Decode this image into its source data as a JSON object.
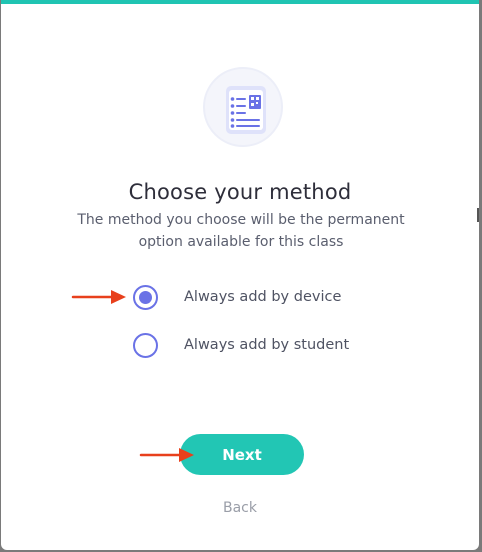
{
  "dialog": {
    "title": "Choose your method",
    "subtitle": "The method you choose will be the permanent option available for this class",
    "illustration_icon": "device-qr-list-icon"
  },
  "options": [
    {
      "label": "Always add by device",
      "selected": true
    },
    {
      "label": "Always add by student",
      "selected": false
    }
  ],
  "actions": {
    "next_label": "Next",
    "back_label": "Back"
  },
  "annotations": {
    "arrow_icon": "red-arrow-icon",
    "arrow_color": "#e8401c"
  },
  "colors": {
    "accent": "#22c6b4",
    "radio": "#6a72e6"
  }
}
